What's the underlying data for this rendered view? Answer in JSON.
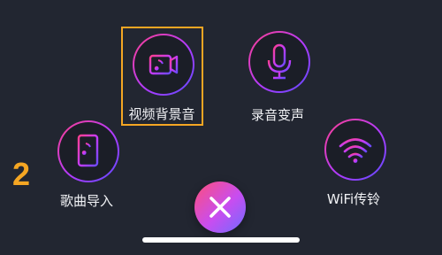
{
  "menu": {
    "items": [
      {
        "key": "video_ringtone",
        "label": "视频背景音",
        "icon": "video-music-icon"
      },
      {
        "key": "voice_changer",
        "label": "录音变声",
        "icon": "microphone-icon"
      },
      {
        "key": "song_import",
        "label": "歌曲导入",
        "icon": "phone-music-icon"
      },
      {
        "key": "wifi_transfer",
        "label": "WiFi传铃",
        "icon": "wifi-icon"
      }
    ],
    "highlighted": "视频背景音"
  },
  "annotation": {
    "step_number": "2"
  },
  "close": {
    "icon": "close-icon"
  },
  "colors": {
    "background": "#222631",
    "highlight": "#f5a623",
    "gradient_pink": "#ff3f8e",
    "gradient_purple": "#b13bff",
    "gradient_blue": "#5b4bff"
  }
}
